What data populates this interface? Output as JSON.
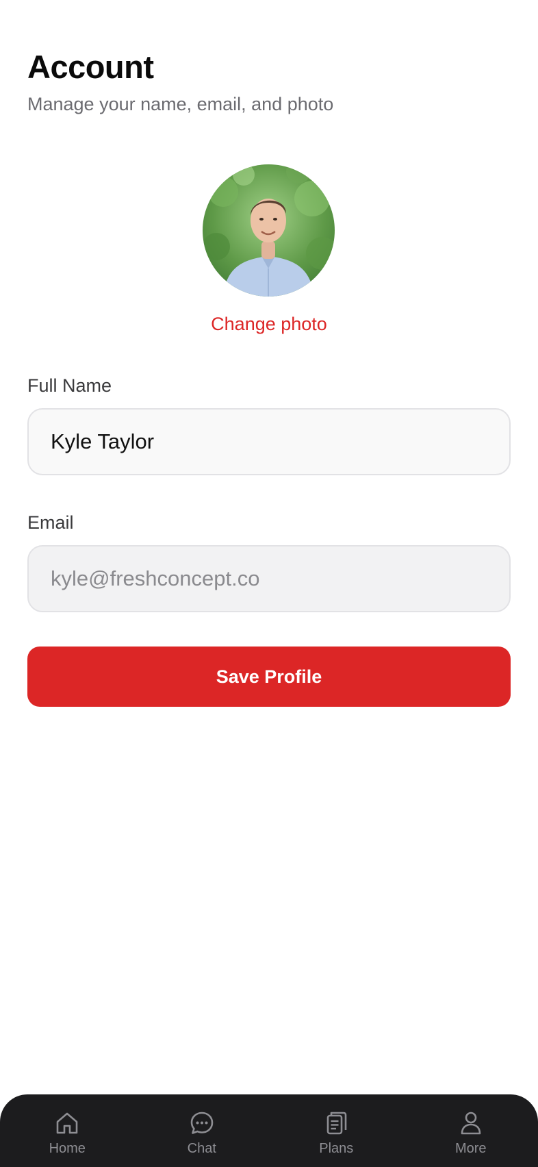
{
  "header": {
    "title": "Account",
    "subtitle": "Manage your name, email, and photo"
  },
  "profile": {
    "avatar_icon": "user-photo",
    "change_photo_label": "Change photo"
  },
  "form": {
    "name_label": "Full Name",
    "name_value": "Kyle Taylor",
    "email_label": "Email",
    "email_value": "kyle@freshconcept.co",
    "save_label": "Save Profile"
  },
  "tabbar": {
    "items": [
      {
        "label": "Home",
        "icon": "home-icon"
      },
      {
        "label": "Chat",
        "icon": "chat-icon"
      },
      {
        "label": "Plans",
        "icon": "clipboard-icon"
      },
      {
        "label": "More",
        "icon": "person-icon"
      }
    ]
  },
  "colors": {
    "accent": "#dc2626",
    "tabbar_bg": "#1c1c1e",
    "tab_inactive": "#8e8e93"
  }
}
